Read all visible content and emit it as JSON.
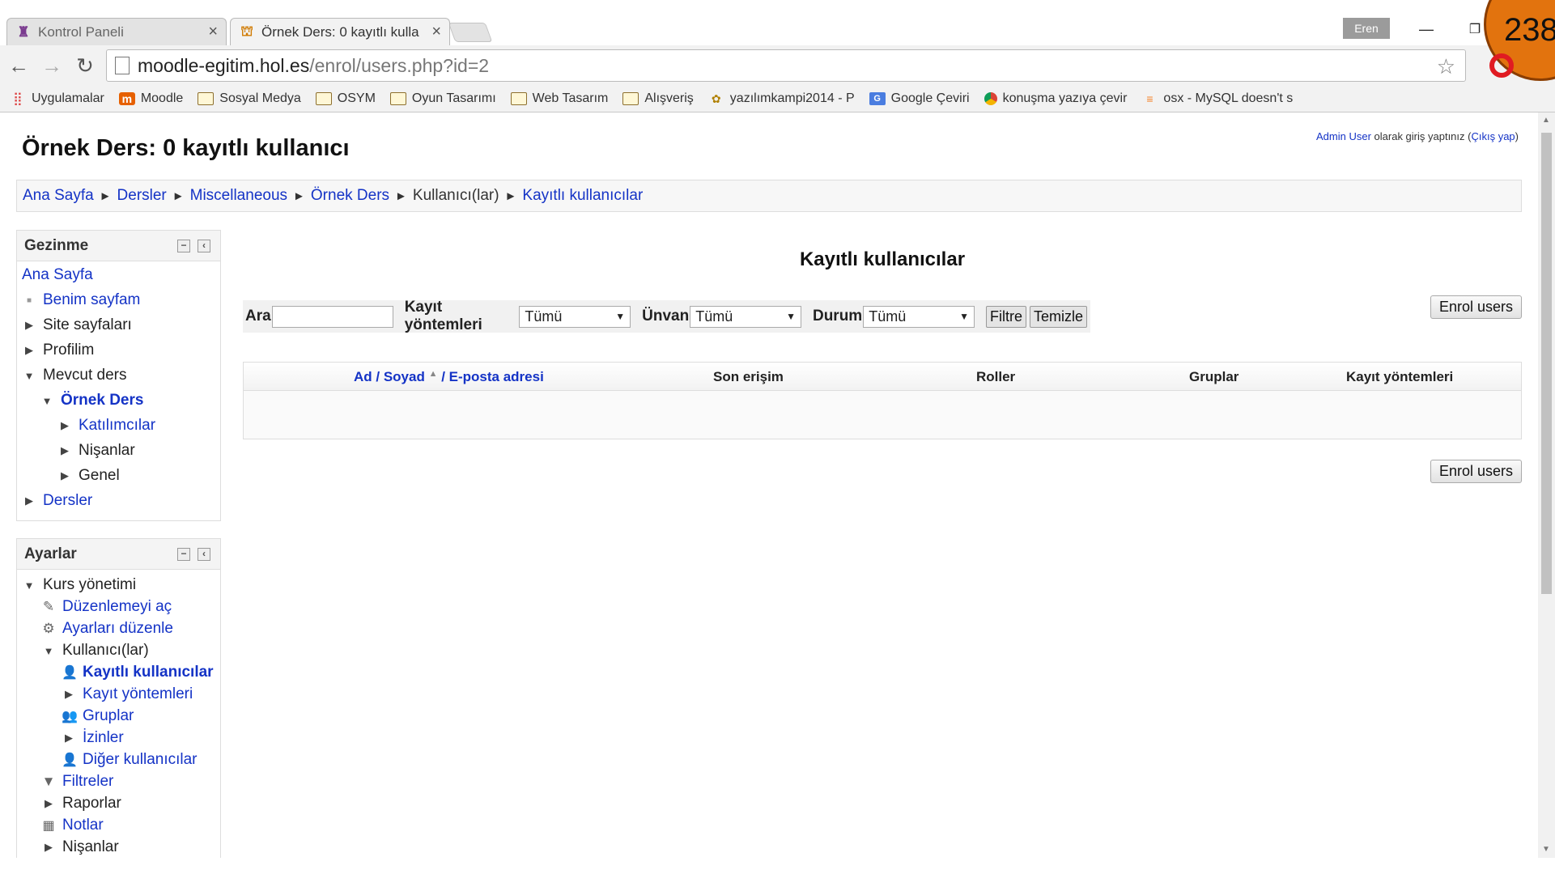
{
  "tabs": [
    {
      "title": "Kontrol Paneli",
      "icon": "moodle-hat-icon"
    },
    {
      "title": "Örnek Ders: 0 kayıtlı kulla",
      "icon": "moodle-cap-icon"
    }
  ],
  "window": {
    "user": "Eren",
    "badge": "238"
  },
  "address": {
    "host": "moodle-egitim.hol.es",
    "path": "/enrol/users.php?id=2"
  },
  "bookmarks": [
    {
      "label": "Uygulamalar",
      "icon": "apps-grid-icon"
    },
    {
      "label": "Moodle",
      "icon": "moodle-icon"
    },
    {
      "label": "Sosyal Medya",
      "icon": "folder-icon"
    },
    {
      "label": "OSYM",
      "icon": "folder-icon"
    },
    {
      "label": "Oyun Tasarımı",
      "icon": "folder-icon"
    },
    {
      "label": "Web Tasarım",
      "icon": "folder-icon"
    },
    {
      "label": "Alışveriş",
      "icon": "folder-icon"
    },
    {
      "label": "yazılımkampi2014 - P",
      "icon": "site-icon"
    },
    {
      "label": "Google Çeviri",
      "icon": "translate-icon"
    },
    {
      "label": "konuşma yazıya çevir",
      "icon": "chrome-icon"
    },
    {
      "label": "osx - MySQL doesn't s",
      "icon": "stackoverflow-icon"
    }
  ],
  "login": {
    "user_link": "Admin User",
    "text": " olarak giriş yaptınız (",
    "logout": "Çıkış yap",
    "close": ")"
  },
  "page_title": "Örnek Ders: 0 kayıtlı kullanıcı",
  "breadcrumb": [
    {
      "label": "Ana Sayfa",
      "link": true
    },
    {
      "label": "Dersler",
      "link": true
    },
    {
      "label": "Miscellaneous",
      "link": true
    },
    {
      "label": "Örnek Ders",
      "link": true
    },
    {
      "label": "Kullanıcı(lar)",
      "link": false
    },
    {
      "label": "Kayıtlı kullanıcılar",
      "link": true
    }
  ],
  "navigation": {
    "title": "Gezinme",
    "items": {
      "home": "Ana Sayfa",
      "my_page": "Benim sayfam",
      "site_pages": "Site sayfaları",
      "profile": "Profilim",
      "current_course": "Mevcut ders",
      "course": "Örnek Ders",
      "participants": "Katılımcılar",
      "badges": "Nişanlar",
      "general": "Genel",
      "courses": "Dersler"
    }
  },
  "settings": {
    "title": "Ayarlar",
    "items": {
      "course_admin": "Kurs yönetimi",
      "edit_on": "Düzenlemeyi aç",
      "edit_settings": "Ayarları düzenle",
      "users": "Kullanıcı(lar)",
      "enrolled": "Kayıtlı kullanıcılar",
      "enrol_methods": "Kayıt yöntemleri",
      "groups": "Gruplar",
      "permissions": "İzinler",
      "other_users": "Diğer kullanıcılar",
      "filters": "Filtreler",
      "reports": "Raporlar",
      "grades": "Notlar",
      "badges": "Nişanlar"
    }
  },
  "main": {
    "heading": "Kayıtlı kullanıcılar",
    "filter": {
      "search_label": "Ara",
      "search_value": "",
      "method_label": "Kayıt yöntemleri",
      "method_value": "Tümü",
      "role_label": "Ünvan",
      "role_value": "Tümü",
      "status_label": "Durum",
      "status_value": "Tümü",
      "filter_btn": "Filtre",
      "reset_btn": "Temizle"
    },
    "enrol_btn": "Enrol users",
    "columns": {
      "name": "Ad / Soyad",
      "email": " / E-posta adresi",
      "last_access": "Son erişim",
      "roles": "Roller",
      "groups": "Gruplar",
      "methods": "Kayıt yöntemleri"
    }
  }
}
